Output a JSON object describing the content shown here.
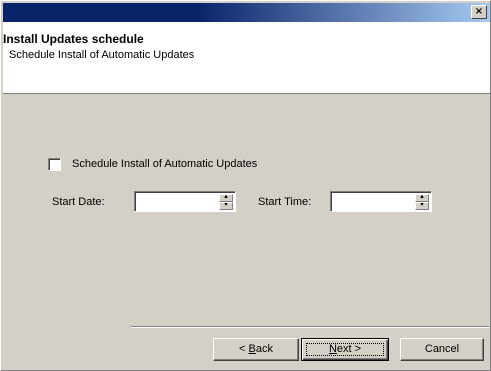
{
  "titlebar": {
    "close_label": "×"
  },
  "header": {
    "title": "Install Updates schedule",
    "subtitle": "Schedule Install of Automatic Updates"
  },
  "schedule": {
    "checkbox_label": "Schedule Install of Automatic Updates",
    "checked": false,
    "start_date_label": "Start Date:",
    "start_date_value": "",
    "start_time_label": "Start Time:",
    "start_time_value": ""
  },
  "spinner": {
    "up_glyph": "▲",
    "down_glyph": "▼"
  },
  "buttons": {
    "back_prefix": "< ",
    "back_mnemonic": "B",
    "back_rest": "ack",
    "next_mnemonic": "N",
    "next_rest": "ext >",
    "cancel_label": "Cancel"
  }
}
